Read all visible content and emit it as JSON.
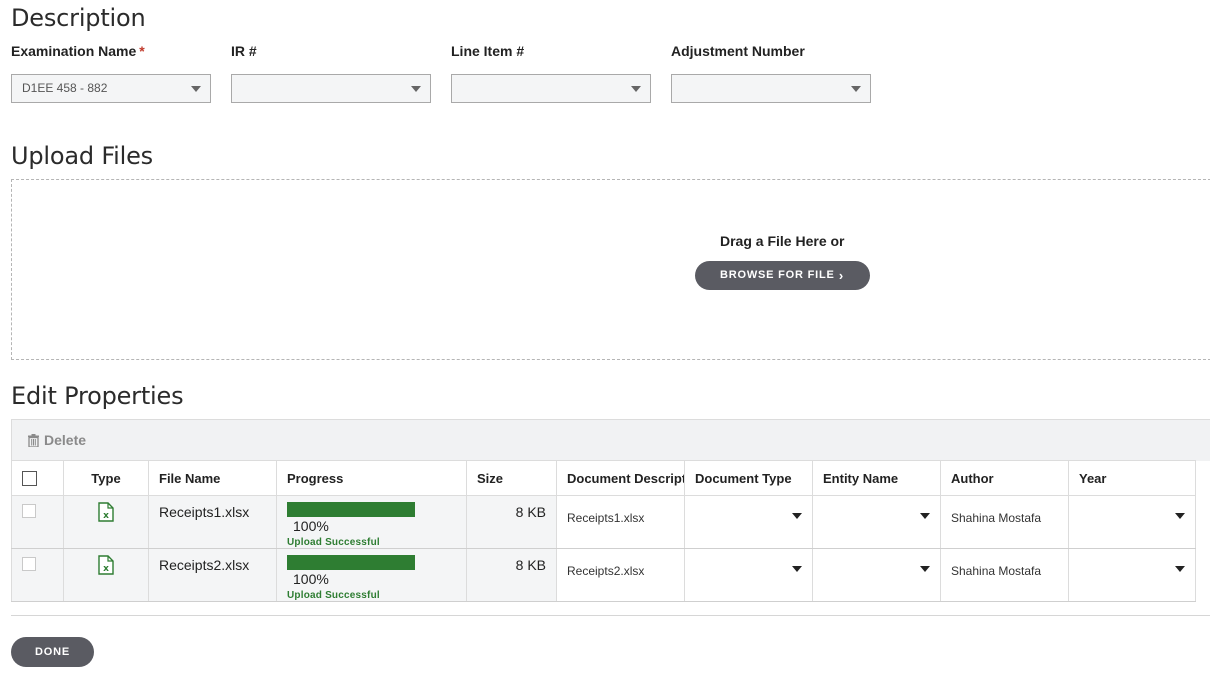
{
  "description": {
    "title": "Description",
    "fields": [
      {
        "label": "Examination Name",
        "required": true,
        "value": "D1EE 458 - 882"
      },
      {
        "label": "IR #",
        "value": ""
      },
      {
        "label": "Line Item #",
        "value": ""
      },
      {
        "label": "Adjustment Number",
        "value": ""
      }
    ],
    "required_marker": "*"
  },
  "upload": {
    "title": "Upload Files",
    "drag_text": "Drag a File Here or",
    "browse_label": "BROWSE FOR FILE",
    "browse_icon": "chevron-right-icon"
  },
  "edit": {
    "title": "Edit Properties",
    "delete_label": "Delete",
    "delete_icon": "trash-icon",
    "columns": [
      "Type",
      "File Name",
      "Progress",
      "Size",
      "Document Description",
      "Document Type",
      "Entity Name",
      "Author",
      "Year"
    ],
    "rows": [
      {
        "type_icon": "excel-file-icon",
        "file_name": "Receipts1.xlsx",
        "progress": 100,
        "progress_label": "100%",
        "status": "Upload Successful",
        "size": "8 KB",
        "description": "Receipts1.xlsx",
        "doc_type": "",
        "entity": "",
        "author": "Shahina Mostafa",
        "year": ""
      },
      {
        "type_icon": "excel-file-icon",
        "file_name": "Receipts2.xlsx",
        "progress": 100,
        "progress_label": "100%",
        "status": "Upload Successful",
        "size": "8 KB",
        "description": "Receipts2.xlsx",
        "doc_type": "",
        "entity": "",
        "author": "Shahina Mostafa",
        "year": ""
      }
    ]
  },
  "footer": {
    "done_label": "DONE"
  },
  "colors": {
    "progress": "#2e7d32",
    "button": "#5a5b62",
    "required": "#c0392b"
  }
}
